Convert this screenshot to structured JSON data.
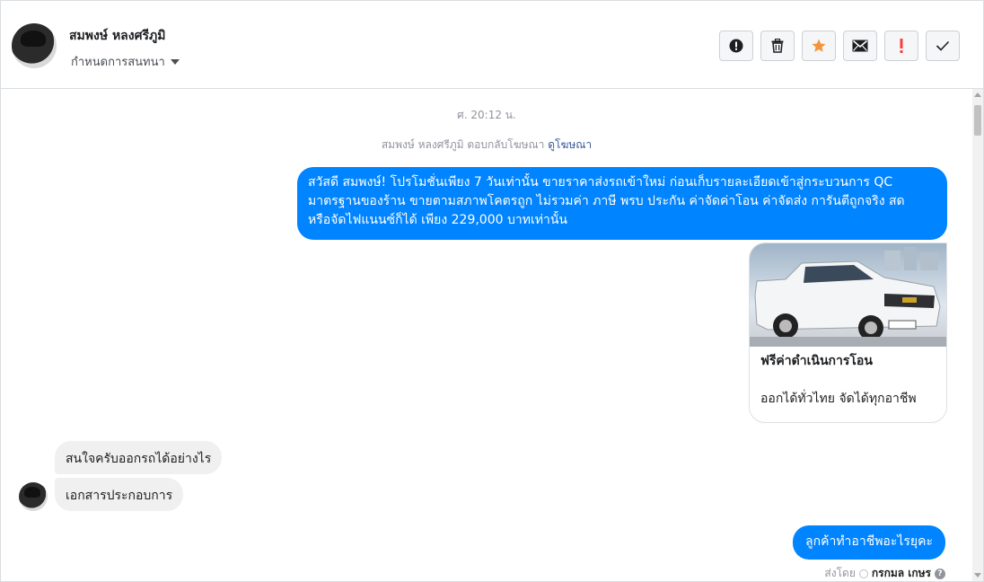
{
  "header": {
    "name": "สมพงษ์ หลงศรีภูมิ",
    "assign_label": "กำหนดการสนทนา",
    "toolbar": [
      {
        "icon": "spam-icon"
      },
      {
        "icon": "trash-icon"
      },
      {
        "icon": "star-icon",
        "color": "#f7923b"
      },
      {
        "icon": "envelope-icon"
      },
      {
        "icon": "important-icon",
        "color": "#fa3e3e"
      },
      {
        "icon": "check-icon"
      }
    ]
  },
  "chat": {
    "timestamp": "ศ. 20:12 น.",
    "ad_reply_text": "สมพงษ์ หลงศรีภูมิ ตอบกลับโฆษณา",
    "ad_link": "ดูโฆษณา",
    "promo_message": {
      "line1": "สวัสดี สมพงษ์! โปรโมชั่นเพียง 7 วันเท่านั้น ขายราคาส่งรถเข้าใหม่ ก่อนเก็บรายละเอียดเข้าสู่กระบวนการ QC",
      "line2": "มาตรฐานของร้าน ขายตามสภาพโคตรถูก ไม่รวมค่า ภาษี พรบ ประกัน ค่าจัดค่าโอน ค่าจัดส่ง การันตีถูกจริง สด",
      "line3": "หรือจัดไฟแนนซ์ก็ได้  เพียง 229,000 บาทเท่านั้น"
    },
    "card": {
      "title": "ฟรีค่าดำเนินการโอน",
      "description": "ออกได้ทั่วไทย จัดได้ทุกอาชีพ"
    },
    "incoming": [
      "สนใจครับออกรถได้อย่างไร",
      "เอกสารประกอบการ"
    ],
    "reply": "ลูกค้าทำอาชีพอะไรยุคะ",
    "sent_by_label": "ส่งโดย",
    "sent_by_agent": "กรกมล เกษร",
    "colors": {
      "outgoing": "#0084ff",
      "incoming": "#f1f0f0"
    }
  }
}
